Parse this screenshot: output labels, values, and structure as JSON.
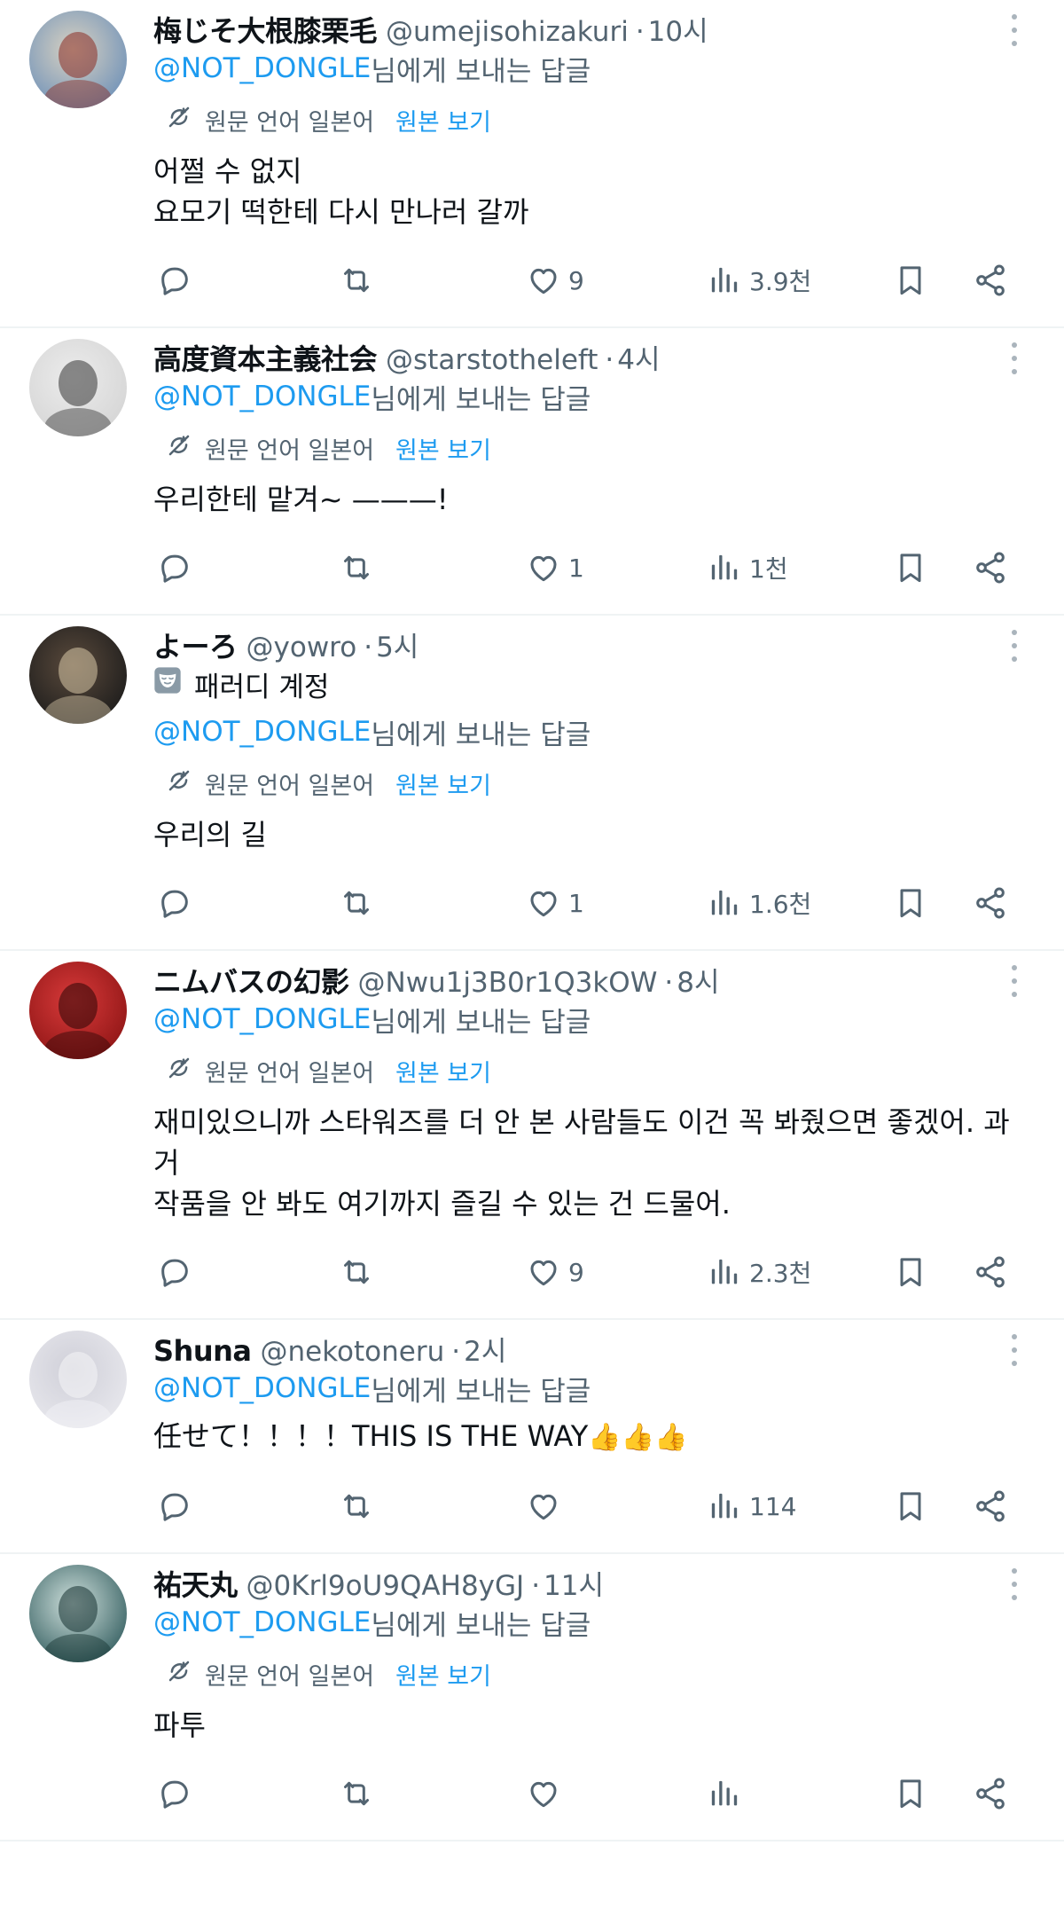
{
  "reply_prefix": "@NOT_DONGLE",
  "reply_suffix": " 님에게 보내는 답글",
  "translate_label": "원문 언어 일본어",
  "view_original": "원본 보기",
  "tweets": [
    {
      "name": "梅じそ大根膝栗毛",
      "handle": "@umejisohizakuri",
      "time": "10시",
      "parody": "",
      "translated": true,
      "text": "어쩔 수 없지\n요모기 떡한테 다시 만나러 갈까",
      "likes": "9",
      "views": "3.9천",
      "avatar_colors": [
        "#6b8fb8",
        "#d9d2c2",
        "#8a2b22"
      ]
    },
    {
      "name": "高度資本主義社会",
      "handle": "@starstotheleft",
      "time": "4시",
      "parody": "",
      "translated": true,
      "text": "우리한테 맡겨~ ———!",
      "likes": "1",
      "views": "1천",
      "avatar_colors": [
        "#d4d4d4",
        "#ececec",
        "#333333"
      ]
    },
    {
      "name": "よーろ",
      "handle": "@yowro",
      "time": "5시",
      "parody": "패러디 계정",
      "translated": true,
      "text": "우리의 길",
      "likes": "1",
      "views": "1.6천",
      "avatar_colors": [
        "#1a1a1a",
        "#5a4a3c",
        "#d8c8a8"
      ]
    },
    {
      "name": "ニムバスの幻影",
      "handle": "@Nwu1j3B0r1Q3kOW",
      "time": "8시",
      "parody": "",
      "translated": true,
      "text": "재미있으니까 스타워즈를 더 안 본 사람들도 이건 꼭 봐줬으면 좋겠어. 과거\n작품을 안 봐도 여기까지 즐길 수 있는 건 드물어.",
      "likes": "9",
      "views": "2.3천",
      "avatar_colors": [
        "#8c1414",
        "#d83a3a",
        "#2a0606"
      ]
    },
    {
      "name": "Shuna",
      "handle": "@nekotoneru",
      "time": "2시",
      "parody": "",
      "translated": false,
      "text": "任せて！！！！THIS IS THE WAY",
      "emoji": "👍👍👍",
      "likes": "",
      "views": "114",
      "avatar_colors": [
        "#e9e9ee",
        "#cfcfd8",
        "#f5f5f8"
      ]
    },
    {
      "name": "祐天丸",
      "handle": "@0Krl9oU9QAH8yGJ",
      "time": "11시",
      "parody": "",
      "translated": true,
      "text": "파투",
      "likes": "",
      "views": "",
      "avatar_colors": [
        "#2f5a5c",
        "#cfe0dc",
        "#14302f"
      ]
    }
  ]
}
